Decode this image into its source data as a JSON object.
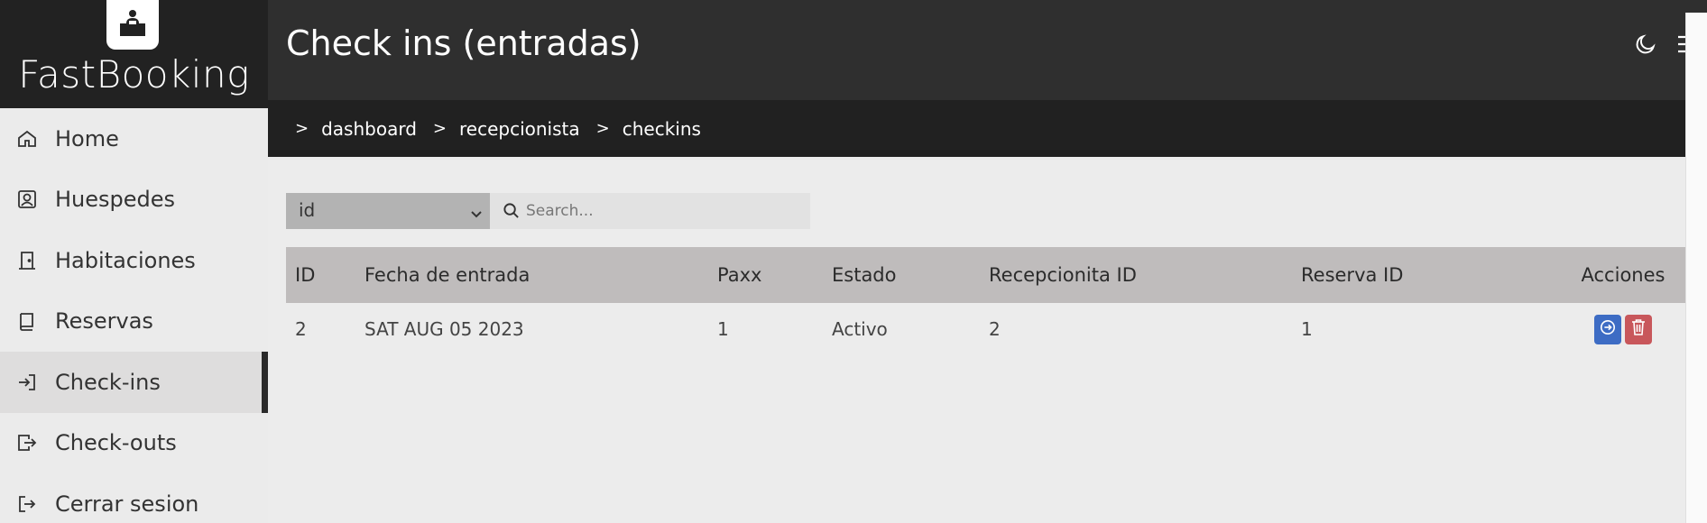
{
  "brand": {
    "name": "FastBooking",
    "logo_icon": "reception-desk-icon"
  },
  "header": {
    "title": "Check ins (entradas)"
  },
  "breadcrumb": [
    "dashboard",
    "recepcionista",
    "checkins"
  ],
  "sidebar": {
    "items": [
      {
        "label": "Home",
        "icon": "home-icon",
        "active": false
      },
      {
        "label": "Huespedes",
        "icon": "user-card-icon",
        "active": false
      },
      {
        "label": "Habitaciones",
        "icon": "door-icon",
        "active": false
      },
      {
        "label": "Reservas",
        "icon": "book-icon",
        "active": false
      },
      {
        "label": "Check-ins",
        "icon": "sign-in-icon",
        "active": true
      },
      {
        "label": "Check-outs",
        "icon": "sign-out-icon",
        "active": false
      },
      {
        "label": "Cerrar sesion",
        "icon": "logout-icon",
        "active": false
      }
    ]
  },
  "filters": {
    "field_select": "id",
    "search_placeholder": "Search..."
  },
  "table": {
    "columns": [
      "ID",
      "Fecha de entrada",
      "Paxx",
      "Estado",
      "Recepcionita ID",
      "Reserva ID",
      "Acciones"
    ],
    "rows": [
      {
        "id": "2",
        "fecha": "SAT AUG 05 2023",
        "paxx": "1",
        "estado": "Activo",
        "recepcionista_id": "2",
        "reserva_id": "1"
      }
    ]
  },
  "colors": {
    "accent_blue": "#3d6cc4",
    "danger_red": "#c8575b",
    "header_dark": "#2f2f2f"
  }
}
